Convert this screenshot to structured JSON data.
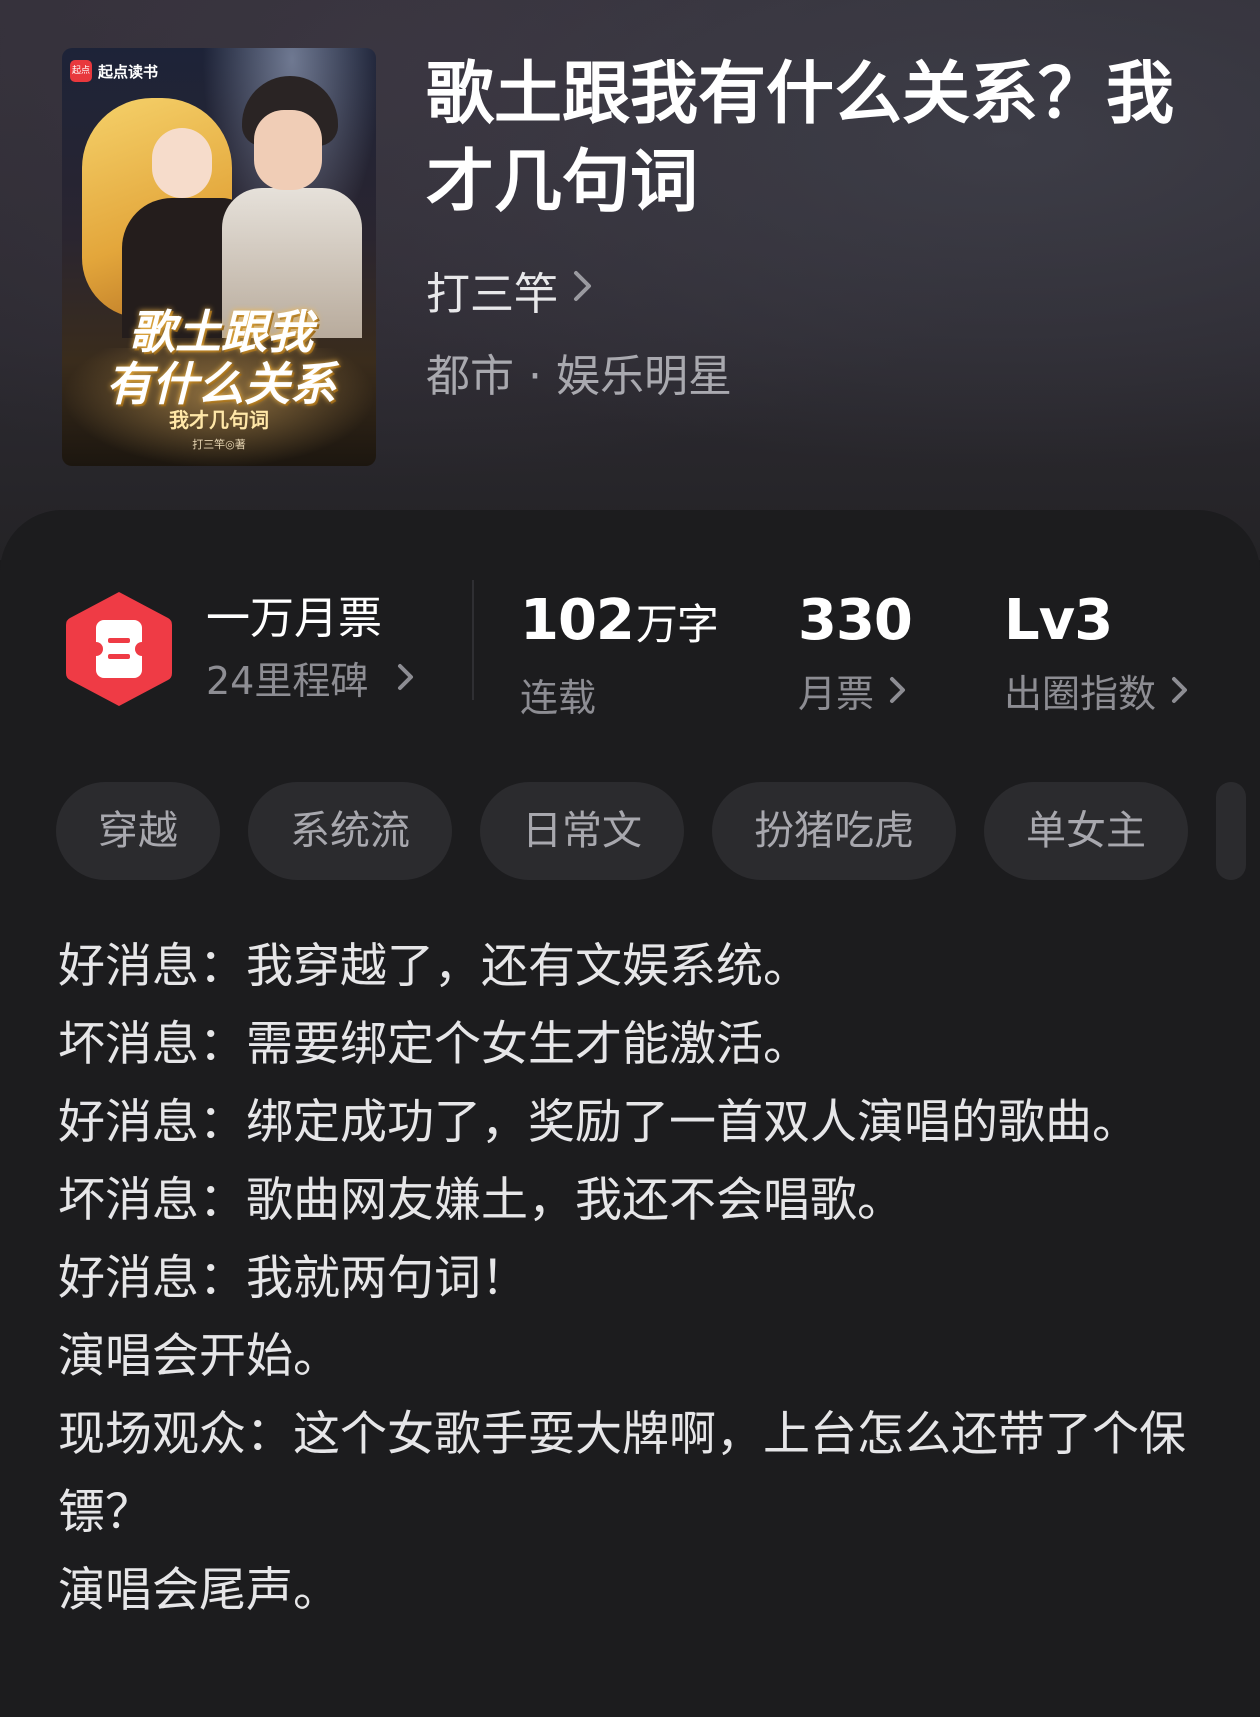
{
  "book": {
    "title": "歌土跟我有什么关系？我才几句词",
    "author": "打三竿",
    "category": "都市 · 娱乐明星"
  },
  "cover": {
    "brand": "起点读书",
    "brand_badge": "起点",
    "title": "歌土跟我\n有什么关系",
    "subtitle": "我才几句词",
    "author": "打三竿◎著"
  },
  "stats": {
    "milestone": {
      "title": "一万月票",
      "subtitle": "24里程碑"
    },
    "word_count": {
      "value": "102",
      "unit": "万字",
      "label": "连载"
    },
    "monthly_votes": {
      "value": "330",
      "label": "月票"
    },
    "influence": {
      "value": "Lv3",
      "label": "出圈指数"
    }
  },
  "tags": [
    "穿越",
    "系统流",
    "日常文",
    "扮猪吃虎",
    "单女主"
  ],
  "synopsis": [
    "好消息：我穿越了，还有文娱系统。",
    "坏消息：需要绑定个女生才能激活。",
    "好消息：绑定成功了，奖励了一首双人演唱的歌曲。",
    "坏消息：歌曲网友嫌土，我还不会唱歌。",
    "好消息：我就两句词！",
    "演唱会开始。",
    "现场观众：这个女歌手耍大牌啊，上台怎么还带了个保镖？",
    "演唱会尾声。"
  ],
  "colors": {
    "milestone_icon": "#ef3b45",
    "panel_bg": "#1c1c1e",
    "tag_bg": "#2b2b2e"
  },
  "icons": {
    "chevron": "chevron-right-icon",
    "milestone": "ticket-badge-icon"
  }
}
